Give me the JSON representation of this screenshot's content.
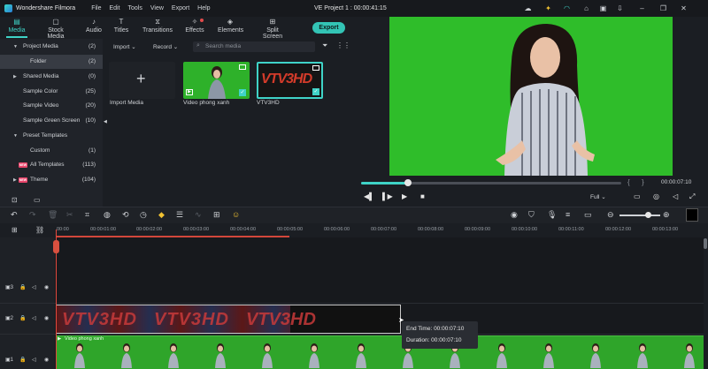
{
  "app": {
    "name": "Wondershare Filmora",
    "project_title": "VE Project 1 : 00:00:41:15"
  },
  "menu": [
    "File",
    "Edit",
    "Tools",
    "View",
    "Export",
    "Help"
  ],
  "tabs": [
    {
      "label": "Media",
      "icon": "media-icon",
      "active": true
    },
    {
      "label": "Stock Media",
      "icon": "stock-media-icon"
    },
    {
      "label": "Audio",
      "icon": "audio-icon"
    },
    {
      "label": "Titles",
      "icon": "titles-icon"
    },
    {
      "label": "Transitions",
      "icon": "transitions-icon"
    },
    {
      "label": "Effects",
      "icon": "effects-icon"
    },
    {
      "label": "Elements",
      "icon": "elements-icon"
    },
    {
      "label": "Split Screen",
      "icon": "split-screen-icon"
    }
  ],
  "export_label": "Export",
  "sidebar": {
    "project_media": {
      "label": "Project Media",
      "count": "(2)"
    },
    "folder": {
      "label": "Folder",
      "count": "(2)"
    },
    "shared_media": {
      "label": "Shared Media",
      "count": "(0)"
    },
    "sample_color": {
      "label": "Sample Color",
      "count": "(25)"
    },
    "sample_video": {
      "label": "Sample Video",
      "count": "(20)"
    },
    "sample_green": {
      "label": "Sample Green Screen",
      "count": "(10)"
    },
    "preset_templates": {
      "label": "Preset Templates"
    },
    "custom": {
      "label": "Custom",
      "count": "(1)"
    },
    "all_templates": {
      "label": "All Templates",
      "count": "(113)",
      "badge": "NEW"
    },
    "theme": {
      "label": "Theme",
      "count": "(104)",
      "badge": "NEW"
    }
  },
  "media_toolbar": {
    "import": "Import",
    "record": "Record",
    "search_placeholder": "Search media"
  },
  "media_items": [
    {
      "label": "Import Media"
    },
    {
      "label": "Video phong xanh"
    },
    {
      "label": "VTV3HD"
    }
  ],
  "vtv_logo": "VTV3HD",
  "player": {
    "timecode": "00:00:07:10",
    "quality": "Full",
    "progress_fraction": 0.18
  },
  "timeline": {
    "ruler": [
      "00:00",
      "00:00:01:00",
      "00:00:02:00",
      "00:00:03:00",
      "00:00:04:00",
      "00:00:05:00",
      "00:00:06:00",
      "00:00:07:00",
      "00:00:08:00",
      "00:00:09:00",
      "00:00:10:00",
      "00:00:11:00",
      "00:00:12:00",
      "00:00:13:00"
    ],
    "track_labels": [
      "3",
      "2",
      "1"
    ],
    "v1_clip_name": "Video phong xanh",
    "tooltip": {
      "end_time": "End Time:  00:00:07:10",
      "duration": "Duration:  00:00:07:10"
    }
  },
  "colors": {
    "accent": "#3fd3c7",
    "green_screen": "#2fbd2a",
    "playhead": "#e44a3e"
  }
}
